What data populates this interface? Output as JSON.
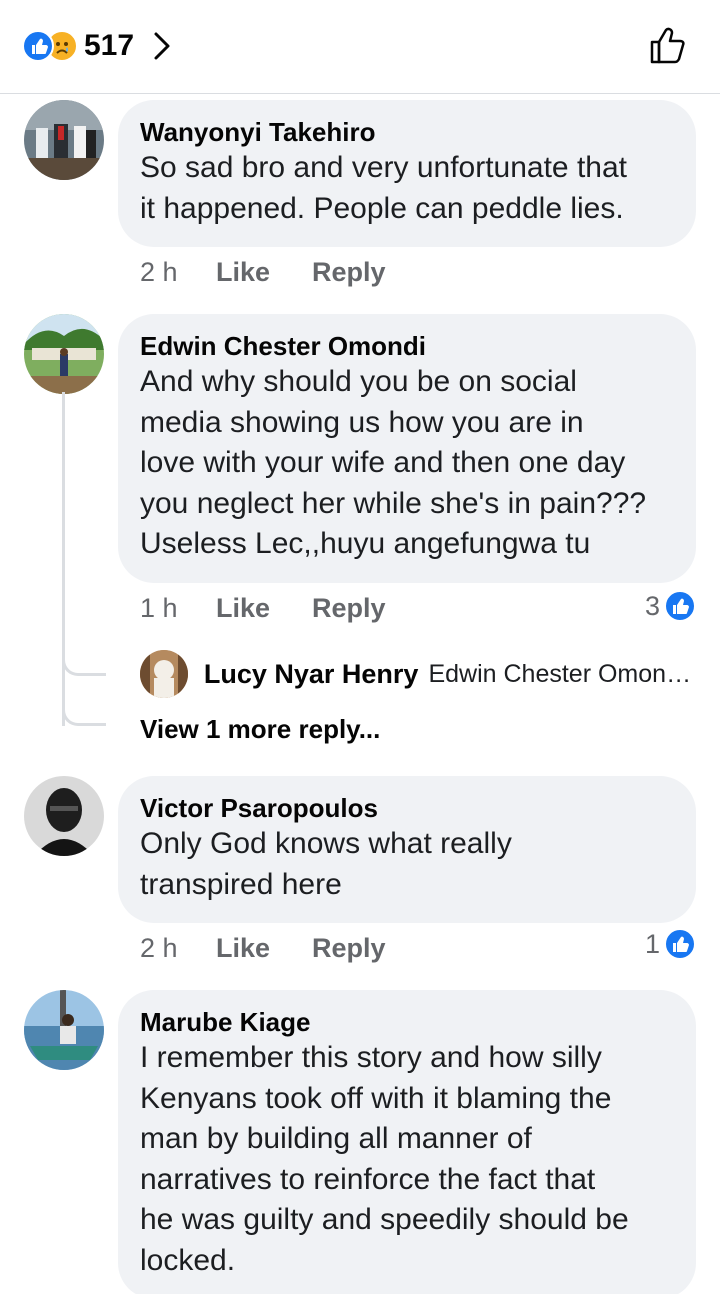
{
  "header": {
    "reaction_count": "517",
    "reactions": [
      "like-icon",
      "sad-icon"
    ]
  },
  "comments": [
    {
      "author": "Wanyonyi Takehiro",
      "lines": [
        "So sad bro and very unfortunate that",
        "it happened. People can peddle lies."
      ],
      "time": "2 h",
      "like_label": "Like",
      "reply_label": "Reply"
    },
    {
      "author": "Edwin Chester Omondi",
      "lines": [
        "And why should you be on social",
        "media showing us how you are in",
        "love with your wife and then one day",
        "you neglect her while she's in pain???",
        "Useless Lec,,huyu angefungwa tu"
      ],
      "time": "1 h",
      "like_label": "Like",
      "reply_label": "Reply",
      "likes": "3",
      "reply": {
        "author": "Lucy Nyar Henry",
        "preview": "Edwin Chester Omond..."
      },
      "view_more": "View 1 more reply..."
    },
    {
      "author": "Victor Psaropoulos",
      "lines": [
        "Only God knows what really",
        "transpired here"
      ],
      "time": "2 h",
      "like_label": "Like",
      "reply_label": "Reply",
      "likes": "1"
    },
    {
      "author": "Marube Kiage",
      "lines": [
        "I remember this story and how silly",
        "Kenyans took off with it blaming the",
        "man by building all manner of",
        "narratives to reinforce the fact that",
        "he was guilty and speedily should be",
        "locked."
      ]
    }
  ],
  "colors": {
    "accent": "#1877f2",
    "bubble": "#f0f2f5",
    "muted": "#65676b"
  }
}
